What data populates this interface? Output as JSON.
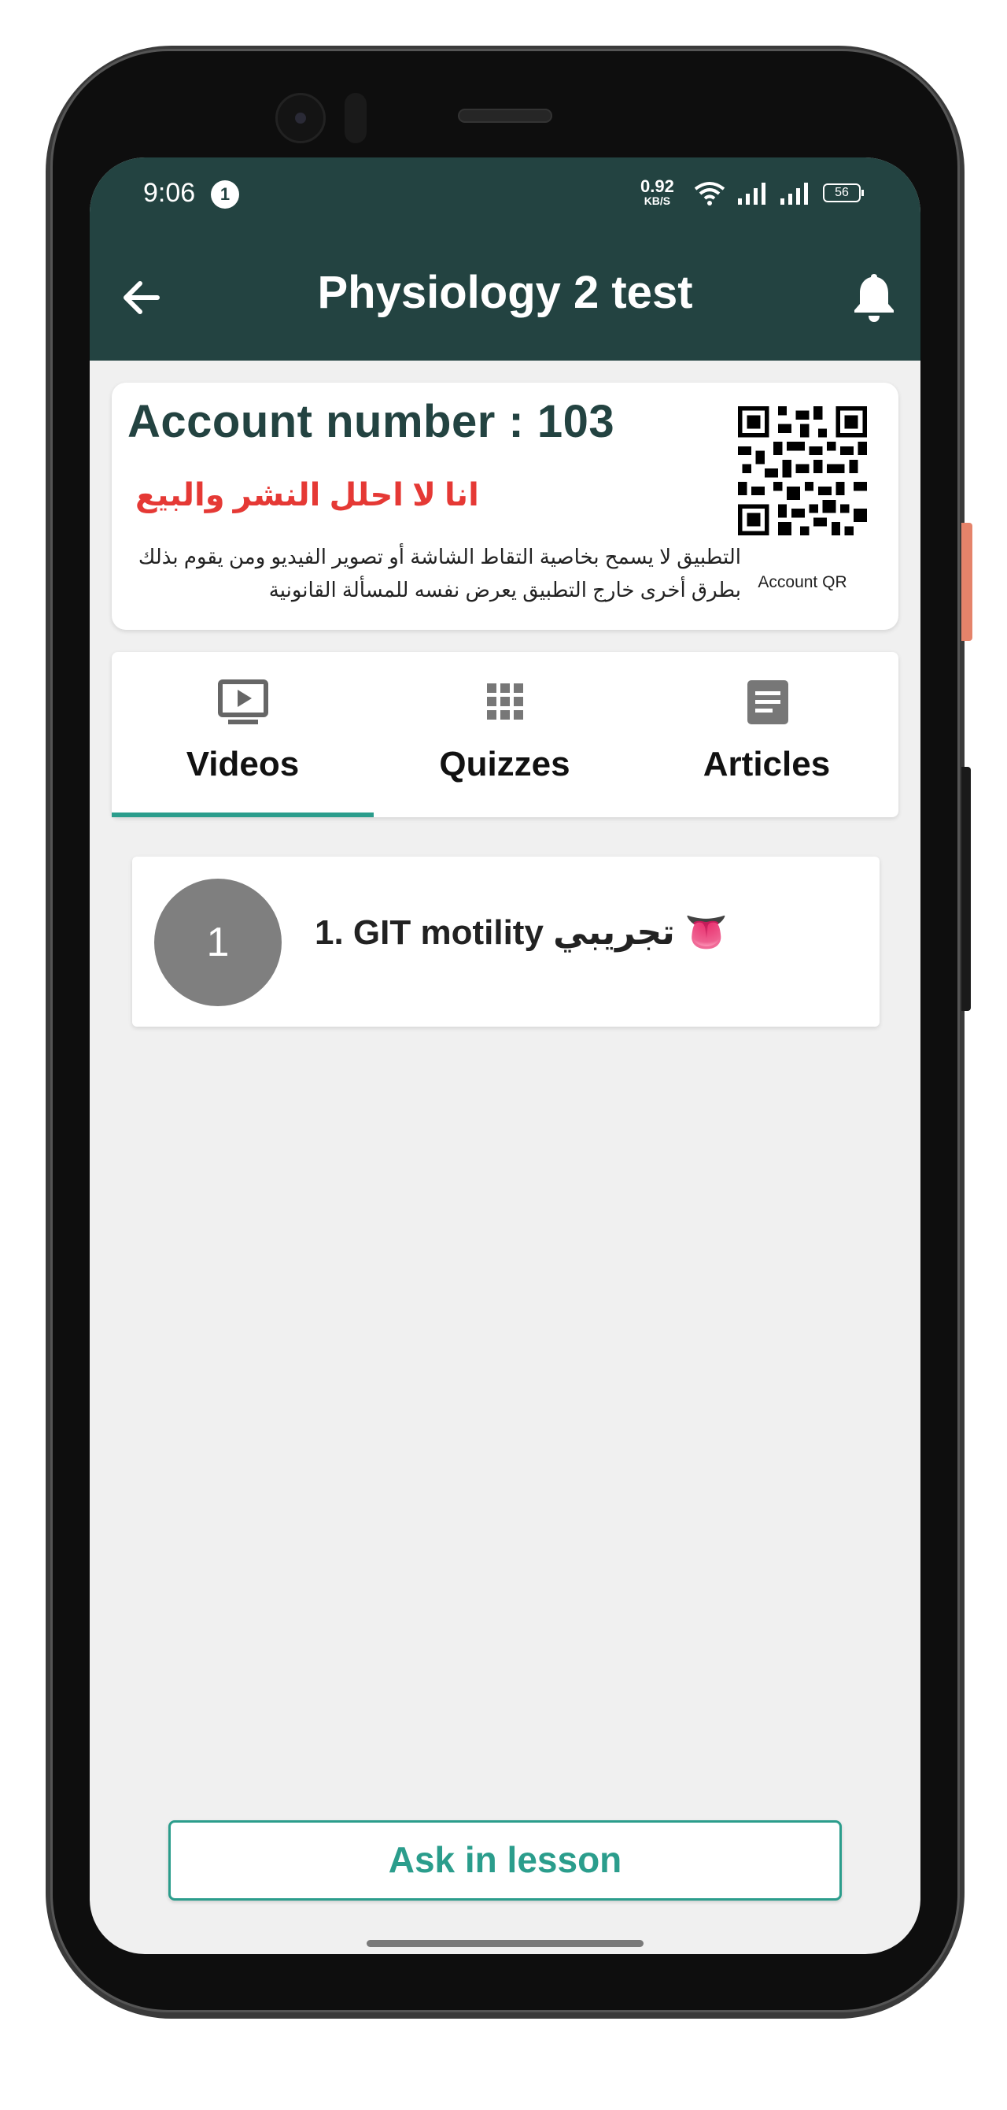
{
  "status_bar": {
    "time": "9:06",
    "notification_count": "1",
    "speed_value": "0.92",
    "speed_unit": "KB/S",
    "battery": "56"
  },
  "header": {
    "title": "Physiology 2 test",
    "back_icon": "arrow-left-icon",
    "bell_icon": "bell-icon",
    "background_color": "#234341"
  },
  "account": {
    "number_label": "Account number : 103",
    "warning": "انا لا احلل النشر والبيع",
    "description": "التطبيق لا يسمح بخاصية التقاط الشاشة أو تصوير الفيديو ومن يقوم بذلك بطرق أخرى خارج التطبيق يعرض نفسه للمسألة القانونية",
    "qr_label": "Account QR"
  },
  "tabs": [
    {
      "label": "Videos",
      "icon": "video-icon",
      "active": true
    },
    {
      "label": "Quizzes",
      "icon": "grid-icon",
      "active": false
    },
    {
      "label": "Articles",
      "icon": "article-icon",
      "active": false
    }
  ],
  "lessons": [
    {
      "number": "1",
      "title": "1. GIT motility تجريبي 👅"
    }
  ],
  "ask_button": {
    "label": "Ask in lesson"
  },
  "colors": {
    "accent": "#2b9d8c",
    "warning": "#e53935"
  }
}
